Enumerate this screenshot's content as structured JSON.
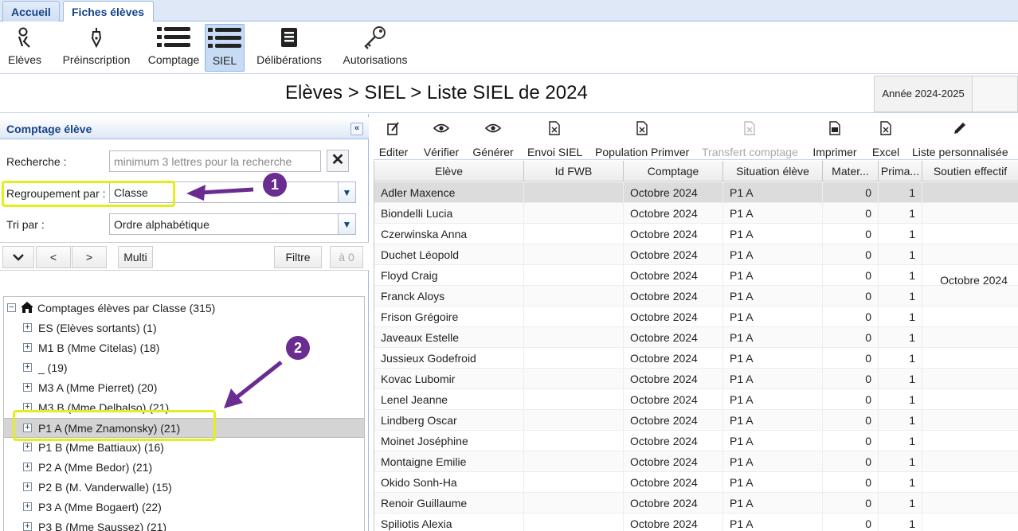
{
  "tabs": [
    {
      "label": "Accueil",
      "active": false
    },
    {
      "label": "Fiches élèves",
      "active": true
    }
  ],
  "ribbon": [
    {
      "label": "Elèves",
      "icon": "student-icon"
    },
    {
      "label": "Préinscription",
      "icon": "pen-icon"
    },
    {
      "label": "Comptage",
      "icon": "list-icon"
    },
    {
      "label": "SIEL",
      "icon": "list-icon",
      "selected": true
    },
    {
      "label": "Délibérations",
      "icon": "document-icon"
    },
    {
      "label": "Autorisations",
      "icon": "key-icon"
    }
  ],
  "title": "Elèves > SIEL > Liste SIEL de 2024",
  "year_button": "Année 2024-2025",
  "left_panel": {
    "header": "Comptage élève",
    "search_label": "Recherche :",
    "search_placeholder": "minimum 3 lettres pour la recherche",
    "group_label": "Regroupement par :",
    "group_value": "Classe",
    "sort_label": "Tri par :",
    "sort_value": "Ordre alphabétique",
    "buttons": {
      "prev": "<",
      "next": ">",
      "multi": "Multi",
      "filter": "Filtre",
      "count": "à 0"
    },
    "date_label": "_ Octobre 2024",
    "tree_root": "Comptages élèves par Classe (315)",
    "tree_items": [
      "ES (Elèves sortants) (1)",
      "M1 B (Mme Citelas) (18)",
      "_ (19)",
      "M3 A (Mme Pierret) (20)",
      "M3 B (Mme Delbalso) (21)",
      "P1 A (Mme Znamonsky) (21)",
      "P1 B (Mme Battiaux) (16)",
      "P2 A (Mme Bedor) (21)",
      "P2 B (M. Vanderwalle) (15)",
      "P3 A (Mme Bogaert) (22)",
      "P3 B (Mme Saussez) (21)"
    ],
    "selected_index": 5
  },
  "actions": [
    {
      "label": "Editer",
      "icon": "edit-icon"
    },
    {
      "label": "Vérifier",
      "icon": "eye-icon"
    },
    {
      "label": "Générer",
      "icon": "eye-icon"
    },
    {
      "label": "Envoi SIEL",
      "icon": "file-x-icon"
    },
    {
      "label": "Population Primver",
      "icon": "file-x-icon"
    },
    {
      "label": "Transfert comptage",
      "icon": "file-x-icon",
      "disabled": true
    },
    {
      "label": "Imprimer",
      "icon": "file-pdf-icon"
    },
    {
      "label": "Excel",
      "icon": "file-x-icon"
    },
    {
      "label": "Liste personnalisée",
      "icon": "pencil-icon"
    }
  ],
  "grid": {
    "columns": [
      "Elève",
      "Id FWB",
      "Comptage",
      "Situation élève",
      "Mater...",
      "Prima...",
      "Soutien effectif"
    ],
    "rows": [
      [
        "Adler Maxence",
        "",
        "Octobre 2024",
        "P1 A",
        "0",
        "1",
        ""
      ],
      [
        "Biondelli Lucia",
        "",
        "Octobre 2024",
        "P1 A",
        "0",
        "1",
        ""
      ],
      [
        "Czerwinska Anna",
        "",
        "Octobre 2024",
        "P1 A",
        "0",
        "1",
        ""
      ],
      [
        "Duchet Léopold",
        "",
        "Octobre 2024",
        "P1 A",
        "0",
        "1",
        ""
      ],
      [
        "Floyd Craig",
        "",
        "Octobre 2024",
        "P1 A",
        "0",
        "1",
        ""
      ],
      [
        "Franck Aloys",
        "",
        "Octobre 2024",
        "P1 A",
        "0",
        "1",
        ""
      ],
      [
        "Frison Grégoire",
        "",
        "Octobre 2024",
        "P1 A",
        "0",
        "1",
        ""
      ],
      [
        "Javeaux Estelle",
        "",
        "Octobre 2024",
        "P1 A",
        "0",
        "1",
        ""
      ],
      [
        "Jussieux Godefroid",
        "",
        "Octobre 2024",
        "P1 A",
        "0",
        "1",
        ""
      ],
      [
        "Kovac Lubomir",
        "",
        "Octobre 2024",
        "P1 A",
        "0",
        "1",
        ""
      ],
      [
        "Lenel Jeanne",
        "",
        "Octobre 2024",
        "P1 A",
        "0",
        "1",
        ""
      ],
      [
        "Lindberg Oscar",
        "",
        "Octobre 2024",
        "P1 A",
        "0",
        "1",
        ""
      ],
      [
        "Moinet Joséphine",
        "",
        "Octobre 2024",
        "P1 A",
        "0",
        "1",
        ""
      ],
      [
        "Montaigne Emilie",
        "",
        "Octobre 2024",
        "P1 A",
        "0",
        "1",
        ""
      ],
      [
        "Okido Sonh-Ha",
        "",
        "Octobre 2024",
        "P1 A",
        "0",
        "1",
        ""
      ],
      [
        "Renoir Guillaume",
        "",
        "Octobre 2024",
        "P1 A",
        "0",
        "1",
        ""
      ],
      [
        "Spiliotis Alexia",
        "",
        "Octobre 2024",
        "P1 A",
        "0",
        "1",
        ""
      ]
    ]
  },
  "annotations": {
    "badge1": "1",
    "badge2": "2"
  },
  "colors": {
    "accent": "#15428b",
    "highlight": "#e3ee1d",
    "annotation": "#6a2c91"
  }
}
